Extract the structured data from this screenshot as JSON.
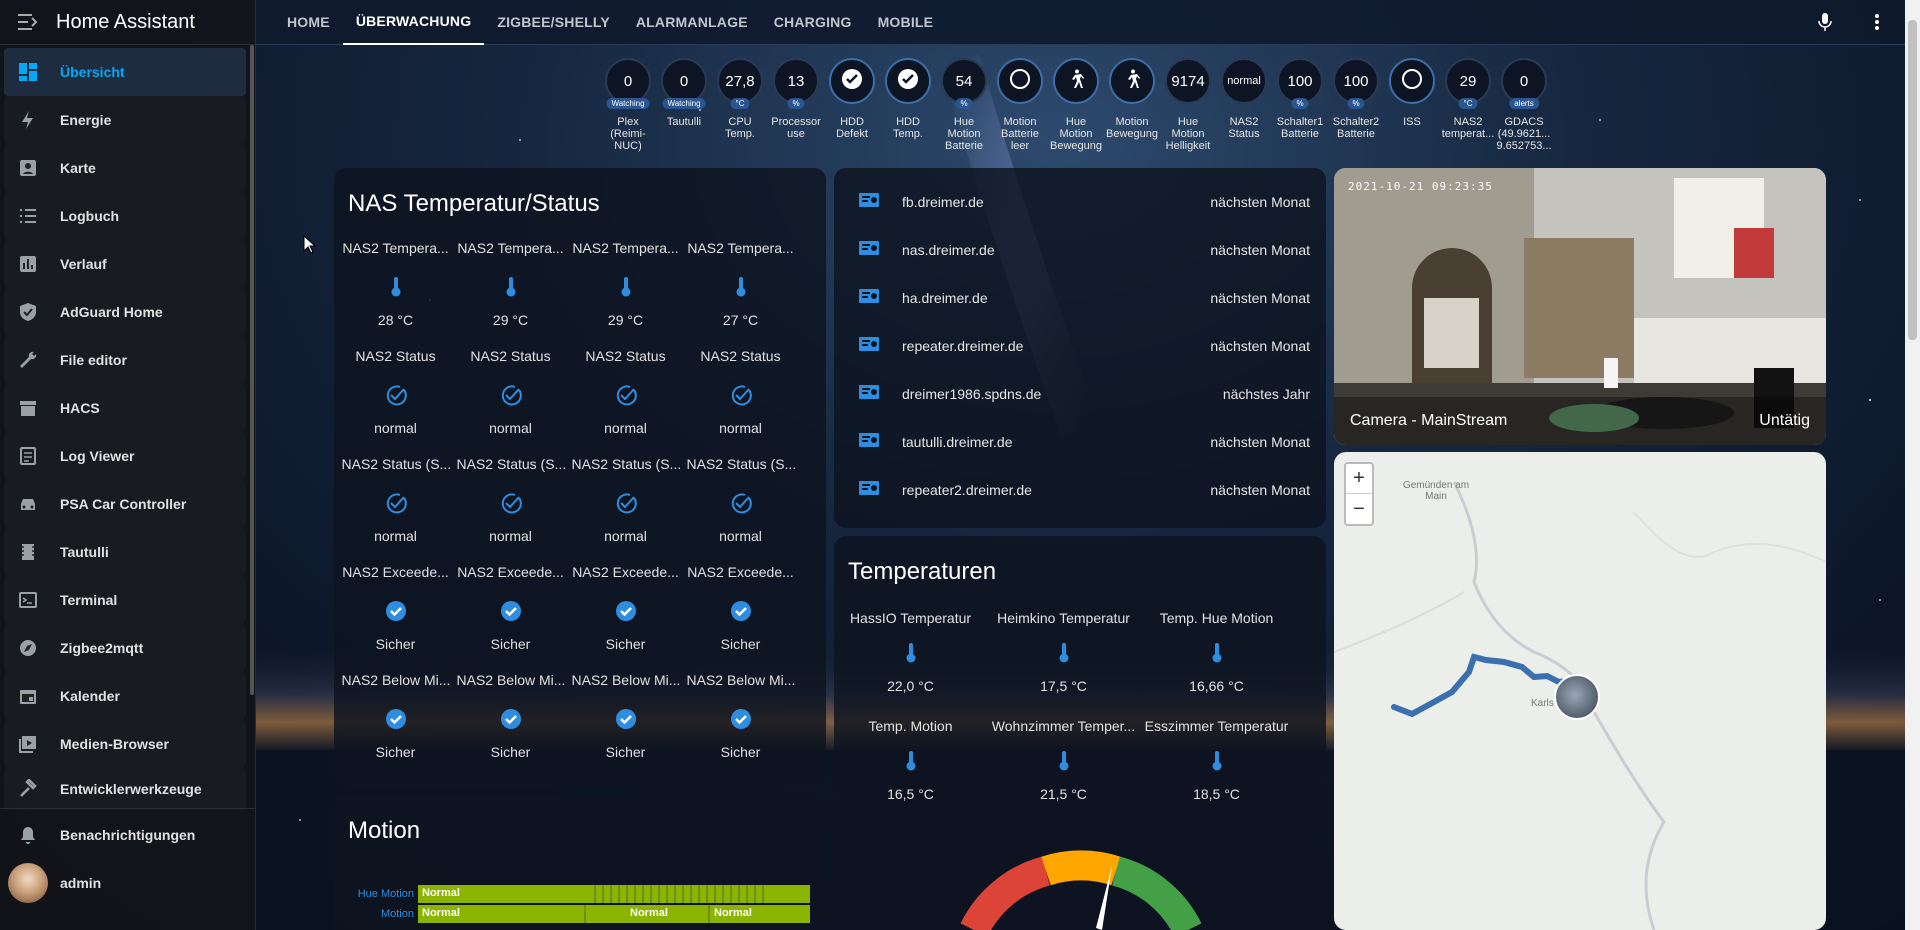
{
  "app": {
    "title": "Home Assistant"
  },
  "sidebar": {
    "items": [
      {
        "label": "Übersicht",
        "icon": "dashboard-icon"
      },
      {
        "label": "Energie",
        "icon": "lightning-icon"
      },
      {
        "label": "Karte",
        "icon": "account-box-icon"
      },
      {
        "label": "Logbuch",
        "icon": "list-icon"
      },
      {
        "label": "Verlauf",
        "icon": "chart-icon"
      },
      {
        "label": "AdGuard Home",
        "icon": "shield-icon"
      },
      {
        "label": "File editor",
        "icon": "wrench-icon"
      },
      {
        "label": "HACS",
        "icon": "store-icon"
      },
      {
        "label": "Log Viewer",
        "icon": "document-icon"
      },
      {
        "label": "PSA Car Controller",
        "icon": "car-icon"
      },
      {
        "label": "Tautulli",
        "icon": "film-icon"
      },
      {
        "label": "Terminal",
        "icon": "console-icon"
      },
      {
        "label": "Zigbee2mqtt",
        "icon": "compass-icon"
      },
      {
        "label": "Kalender",
        "icon": "calendar-icon"
      },
      {
        "label": "Medien-Browser",
        "icon": "media-icon"
      },
      {
        "label": "Entwicklerwerkzeuge",
        "icon": "hammer-icon"
      }
    ],
    "notifications": "Benachrichtigungen",
    "user": "admin"
  },
  "tabs": [
    "HOME",
    "ÜBERWACHUNG",
    "ZIGBEE/SHELLY",
    "ALARMANLAGE",
    "CHARGING",
    "MOBILE"
  ],
  "badges": [
    {
      "value": "0",
      "unit": "Watching",
      "label": "Plex (Reimi-NUC)"
    },
    {
      "value": "0",
      "unit": "Watching",
      "label": "Tautulli"
    },
    {
      "value": "27,8",
      "unit": "°C",
      "label": "CPU Temp."
    },
    {
      "value": "13",
      "unit": "%",
      "label": "Processor use"
    },
    {
      "value": "✓",
      "unit": "",
      "label": "HDD Defekt"
    },
    {
      "value": "✓",
      "unit": "",
      "label": "HDD Temp."
    },
    {
      "value": "54",
      "unit": "%",
      "label": "Hue Motion Batterie"
    },
    {
      "value": "○",
      "unit": "",
      "label": "Motion Batterie leer"
    },
    {
      "value": "walk",
      "unit": "",
      "label": "Hue Motion Bewegung"
    },
    {
      "value": "walk",
      "unit": "",
      "label": "Motion Bewegung"
    },
    {
      "value": "9174",
      "unit": "",
      "label": "Hue Motion Helligkeit"
    },
    {
      "value": "normal",
      "unit": "",
      "label": "NAS2 Status"
    },
    {
      "value": "100",
      "unit": "%",
      "label": "Schalter1 Batterie"
    },
    {
      "value": "100",
      "unit": "%",
      "label": "Schalter2 Batterie"
    },
    {
      "value": "○",
      "unit": "",
      "label": "ISS"
    },
    {
      "value": "29",
      "unit": "°C",
      "label": "NAS2 temperat..."
    },
    {
      "value": "0",
      "unit": "alerts",
      "label": "GDACS (49.9621... 9.652753..."
    }
  ],
  "nas": {
    "title": "NAS Temperatur/Status",
    "rows": [
      {
        "names": [
          "NAS2 Tempera...",
          "NAS2 Tempera...",
          "NAS2 Tempera...",
          "NAS2 Tempera..."
        ],
        "icon": "thermometer-icon",
        "values": [
          "28 °C",
          "29 °C",
          "29 °C",
          "27 °C"
        ]
      },
      {
        "names": [
          "NAS2 Status",
          "NAS2 Status",
          "NAS2 Status",
          "NAS2 Status"
        ],
        "icon": "check-circle-icon",
        "values": [
          "normal",
          "normal",
          "normal",
          "normal"
        ]
      },
      {
        "names": [
          "NAS2 Status (S...",
          "NAS2 Status (S...",
          "NAS2 Status (S...",
          "NAS2 Status (S..."
        ],
        "icon": "check-circle-icon",
        "values": [
          "normal",
          "normal",
          "normal",
          "normal"
        ]
      },
      {
        "names": [
          "NAS2 Exceede...",
          "NAS2 Exceede...",
          "NAS2 Exceede...",
          "NAS2 Exceede..."
        ],
        "icon": "check-filled-icon",
        "values": [
          "Sicher",
          "Sicher",
          "Sicher",
          "Sicher"
        ]
      },
      {
        "names": [
          "NAS2 Below Mi...",
          "NAS2 Below Mi...",
          "NAS2 Below Mi...",
          "NAS2 Below Mi..."
        ],
        "icon": "check-filled-icon",
        "values": [
          "Sicher",
          "Sicher",
          "Sicher",
          "Sicher"
        ]
      }
    ]
  },
  "certs": [
    {
      "name": "fb.dreimer.de",
      "status": "nächsten Monat"
    },
    {
      "name": "nas.dreimer.de",
      "status": "nächsten Monat"
    },
    {
      "name": "ha.dreimer.de",
      "status": "nächsten Monat"
    },
    {
      "name": "repeater.dreimer.de",
      "status": "nächsten Monat"
    },
    {
      "name": "dreimer1986.spdns.de",
      "status": "nächstes Jahr"
    },
    {
      "name": "tautulli.dreimer.de",
      "status": "nächsten Monat"
    },
    {
      "name": "repeater2.dreimer.de",
      "status": "nächsten Monat"
    }
  ],
  "temps": {
    "title": "Temperaturen",
    "items": [
      {
        "name": "HassIO Temperatur",
        "value": "22,0 °C"
      },
      {
        "name": "Heimkino Temperatur",
        "value": "17,5 °C"
      },
      {
        "name": "Temp. Hue Motion",
        "value": "16,66 °C"
      },
      {
        "name": "Temp. Motion",
        "value": "16,5 °C"
      },
      {
        "name": "Wohnzimmer Temper...",
        "value": "21,5 °C"
      },
      {
        "name": "Esszimmer Temperatur",
        "value": "18,5 °C"
      }
    ]
  },
  "camera": {
    "timestamp": "2021-10-21 09:23:35",
    "name": "Camera - MainStream",
    "state": "Untätig"
  },
  "map": {
    "place1": "Gemünden am Main",
    "place2": "Karls",
    "zoom_in": "+",
    "zoom_out": "−"
  },
  "motion": {
    "title": "Motion",
    "rows": [
      {
        "label": "Hue Motion",
        "segments": [
          "Normal"
        ]
      },
      {
        "label": "Motion",
        "segments": [
          "Normal",
          "Normal",
          "Normal"
        ]
      }
    ]
  },
  "colors": {
    "accent": "#03a9f4",
    "icon_blue": "#2f8de0",
    "bar_green": "#8bb400"
  }
}
